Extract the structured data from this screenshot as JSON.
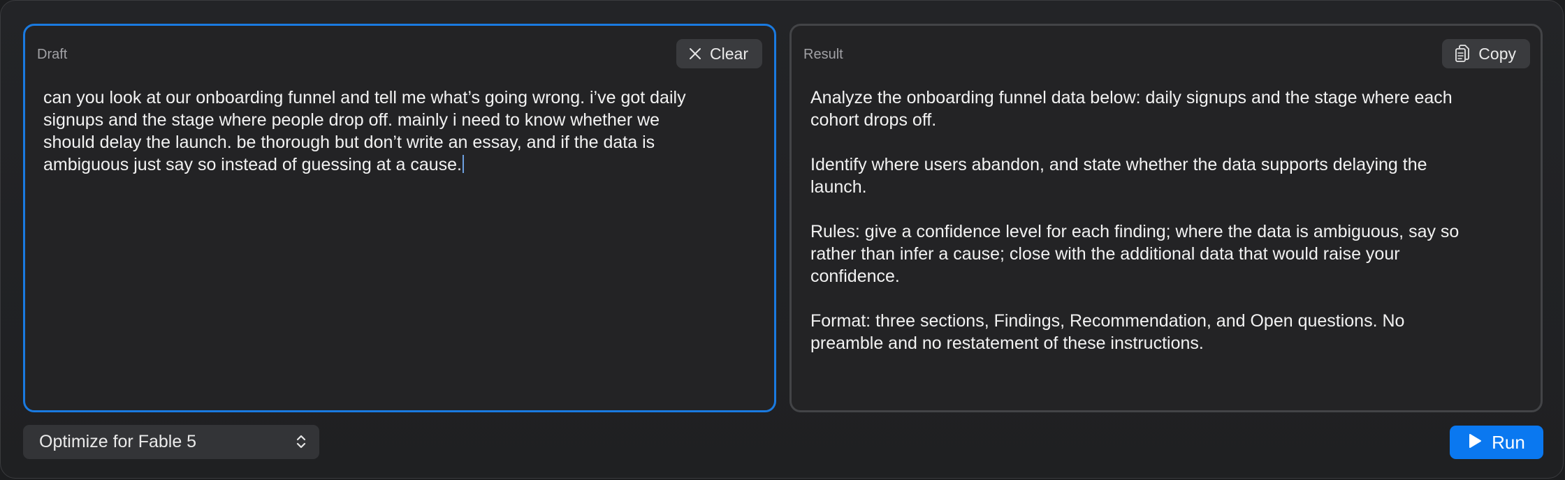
{
  "draft": {
    "label": "Draft",
    "clear_label": "Clear",
    "text": "can you look at our onboarding funnel and tell me what’s going wrong. i’ve got daily\nsignups and the stage where people drop off. mainly i need to know whether we\nshould delay the launch. be thorough but don’t write an essay, and if the data is\nambiguous just say so instead of guessing at a cause."
  },
  "result": {
    "label": "Result",
    "copy_label": "Copy",
    "text": "Analyze the onboarding funnel data below: daily signups and the stage where each\ncohort drops off.\n\nIdentify where users abandon, and state whether the data supports delaying the\nlaunch.\n\nRules: give a confidence level for each finding; where the data is ambiguous, say so\nrather than infer a cause; close with the additional data that would raise your\nconfidence.\n\nFormat: three sections, Findings, Recommendation, and Open questions. No\npreamble and no restatement of these instructions."
  },
  "footer": {
    "model_select_value": "Optimize for Fable 5",
    "run_label": "Run"
  },
  "colors": {
    "accent": "#0a78f0",
    "focus_border": "#1a7ae0",
    "panel_bg": "#232325"
  },
  "icons": {
    "clear": "close-icon",
    "copy": "copy-icon",
    "select": "chevron-up-down-icon",
    "run": "play-icon"
  }
}
